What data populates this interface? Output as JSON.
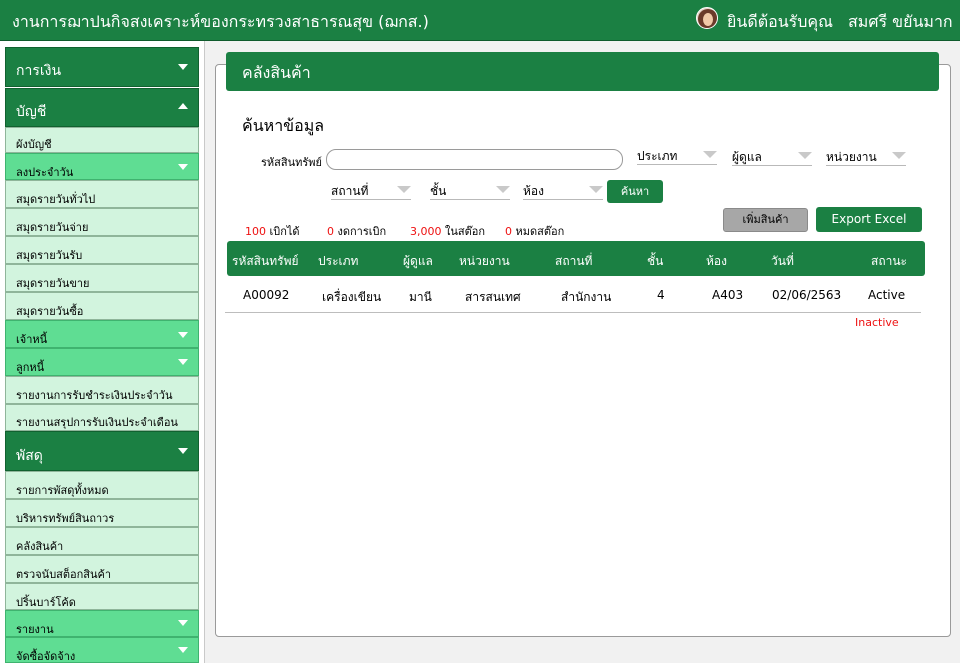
{
  "header": {
    "title": "งานการฌาปนกิจสงเคราะห์ของกระทรวงสาธารณสุข (ฌกส.)",
    "welcome": "ยินดีต้อนรับคุณ",
    "user_name": "สมศรี ขยันมาก"
  },
  "sidebar": {
    "finance": "การเงิน",
    "accounting": "บัญชี",
    "chart_of_accounts": "ผังบัญชี",
    "daily_record": "ลงประจำวัน",
    "general_journal": "สมุดรายวันทั่วไป",
    "payment_journal": "สมุดรายวันจ่าย",
    "receipt_journal": "สมุดรายวันรับ",
    "sales_journal": "สมุดรายวันขาย",
    "purchase_journal": "สมุดรายวันซื้อ",
    "creditors": "เจ้าหนี้",
    "debtors": "ลูกหนี้",
    "daily_payment_report": "รายงานการรับชำระเงินประจำวัน",
    "monthly_summary_report": "รายงานสรุปการรับเงินประจำเดือน",
    "supplies": "พัสดุ",
    "all_supplies": "รายการพัสดุทั้งหมด",
    "durable_assets": "บริหารทรัพย์สินถาวร",
    "warehouse": "คลังสินค้า",
    "stock_count": "ตรวจนับสต็อกสินค้า",
    "print_barcode": "ปริ้นบาร์โค้ด",
    "reports": "รายงาน",
    "procurement": "จัดซื้อจัดจ้าง"
  },
  "panel": {
    "title": "คลังสินค้า",
    "search_title": "ค้นหาข้อมูล",
    "asset_code_label": "รหัสสินทรัพย์",
    "asset_code_value": "",
    "filters": {
      "type": "ประเภท",
      "custodian": "ผู้ดูแล",
      "unit": "หน่วยงาน",
      "location": "สถานที่",
      "floor": "ชั้น",
      "room": "ห้อง"
    },
    "search_button": "ค้นหา",
    "add_button": "เพิ่มสินค้า",
    "excel_button": "Export Excel",
    "stats": [
      {
        "value": "100",
        "label": "เบิกได้"
      },
      {
        "value": "0",
        "label": "งดการเบิก"
      },
      {
        "value": "3,000",
        "label": "ในสต๊อก"
      },
      {
        "value": "0",
        "label": "หมดสต๊อก"
      }
    ],
    "table": {
      "headers": [
        "รหัสสินทรัพย์",
        "ประเภท",
        "ผู้ดูแล",
        "หน่วยงาน",
        "สถานที่",
        "ชั้น",
        "ห้อง",
        "วันที่",
        "สถานะ"
      ],
      "rows": [
        [
          "A00092",
          "เครื่องเขียน",
          "มานี",
          "สารสนเทศ",
          "สำนักงาน",
          "4",
          "A403",
          "02/06/2563",
          "Active"
        ]
      ],
      "inactive_label": "Inactive"
    }
  },
  "colors": {
    "primary_green": "#1b8043",
    "light_green": "#5fdd93",
    "pale_green": "#d2f4de",
    "alert_red": "#e11111"
  }
}
